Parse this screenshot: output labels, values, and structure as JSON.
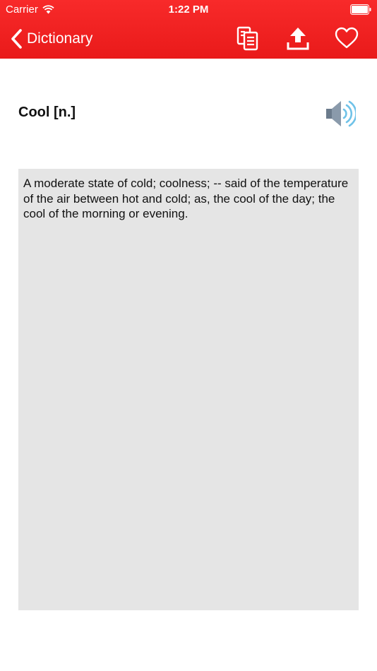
{
  "status_bar": {
    "carrier": "Carrier",
    "time": "1:22 PM"
  },
  "nav": {
    "back_label": "Dictionary",
    "icons": [
      "copy-icon",
      "share-upload-icon",
      "heart-icon"
    ]
  },
  "entry": {
    "headword": "Cool [n.]",
    "definition": "A moderate state of cold; coolness; -- said of the temperature of the air between hot and cold; as, the cool of the day; the cool of the morning or evening."
  },
  "colors": {
    "bar_red": "#f12222",
    "definition_bg": "#e5e5e5",
    "speaker_wave": "#6fc2e8"
  }
}
